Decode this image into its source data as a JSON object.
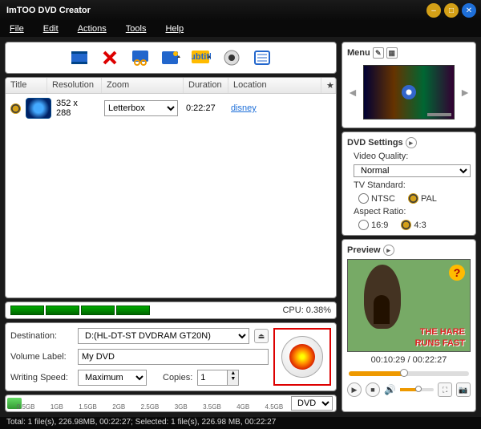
{
  "window": {
    "title": "ImTOO DVD Creator"
  },
  "menu": {
    "file": "File",
    "edit": "Edit",
    "actions": "Actions",
    "tools": "Tools",
    "help": "Help"
  },
  "grid": {
    "headers": {
      "title": "Title",
      "resolution": "Resolution",
      "zoom": "Zoom",
      "duration": "Duration",
      "location": "Location",
      "star": "★"
    },
    "rows": [
      {
        "resolution": "352 x 288",
        "zoom": "Letterbox",
        "duration": "0:22:27",
        "location": "disney"
      }
    ]
  },
  "cpu": {
    "label": "CPU: 0.38%"
  },
  "output": {
    "destination_label": "Destination:",
    "destination_value": "D:(HL-DT-ST DVDRAM GT20N)",
    "volume_label": "Volume Label:",
    "volume_value": "My DVD",
    "speed_label": "Writing Speed:",
    "speed_value": "Maximum",
    "copies_label": "Copies:",
    "copies_value": "1"
  },
  "sizebar": {
    "ticks": [
      "0.5GB",
      "1GB",
      "1.5GB",
      "2GB",
      "2.5GB",
      "3GB",
      "3.5GB",
      "4GB",
      "4.5GB"
    ],
    "mode": "DVD"
  },
  "right": {
    "menu_header": "Menu",
    "dvd_header": "DVD Settings",
    "video_quality_label": "Video Quality:",
    "video_quality_value": "Normal",
    "tv_label": "TV Standard:",
    "tv_ntsc": "NTSC",
    "tv_pal": "PAL",
    "aspect_label": "Aspect Ratio:",
    "aspect_169": "16:9",
    "aspect_43": "4:3",
    "preview_header": "Preview",
    "caption_line1": "THE HARE",
    "caption_line2": "RUNS FAST",
    "time": "00:10:29 / 00:22:27"
  },
  "status": "Total: 1 file(s), 226.98MB, 00:22:27; Selected: 1 file(s), 226.98 MB, 00:22:27"
}
